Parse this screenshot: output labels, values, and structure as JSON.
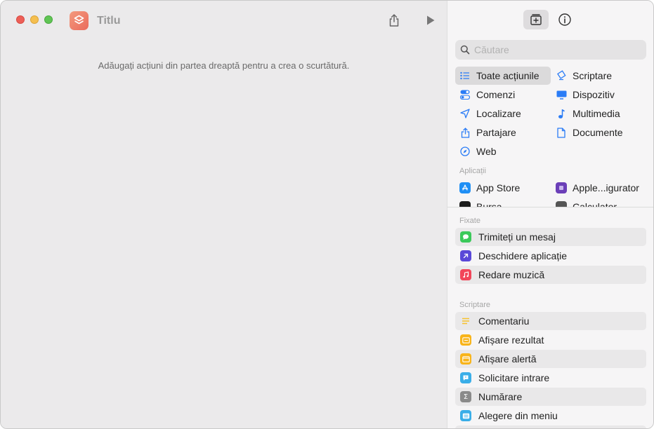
{
  "window": {
    "title": "Titlu",
    "empty_message": "Adăugați acțiuni din partea dreaptă pentru a crea o scurtătură."
  },
  "toolbar": {
    "share_icon": "share-icon",
    "run_icon": "play-icon"
  },
  "sidebar": {
    "library_icon": "action-library-icon",
    "info_icon": "info-icon",
    "search_placeholder": "Căutare",
    "categories": [
      {
        "label": "Toate acțiunile",
        "icon": "list-icon",
        "color": "#2a7cf6",
        "selected": true
      },
      {
        "label": "Scriptare",
        "icon": "scripting-icon",
        "color": "#2a7cf6"
      },
      {
        "label": "Comenzi",
        "icon": "toggle-icon",
        "color": "#2a7cf6"
      },
      {
        "label": "Dispozitiv",
        "icon": "display-icon",
        "color": "#2a7cf6"
      },
      {
        "label": "Localizare",
        "icon": "location-icon",
        "color": "#2a7cf6"
      },
      {
        "label": "Multimedia",
        "icon": "music-note-icon",
        "color": "#2a7cf6"
      },
      {
        "label": "Partajare",
        "icon": "share-icon",
        "color": "#2a7cf6"
      },
      {
        "label": "Documente",
        "icon": "document-icon",
        "color": "#2a7cf6"
      },
      {
        "label": "Web",
        "icon": "compass-icon",
        "color": "#2a7cf6"
      }
    ],
    "apps_label": "Aplicații",
    "apps": [
      {
        "label": "App Store",
        "icon": "app-store-icon",
        "color": "#1f8ff5"
      },
      {
        "label": "Apple...igurator",
        "icon": "configurator-icon",
        "color": "#6b3fb8"
      },
      {
        "label": "Bursa",
        "icon": "stocks-icon",
        "color": "#1c1c1c"
      },
      {
        "label": "Calculator",
        "icon": "calculator-icon",
        "color": "#555555"
      }
    ],
    "pinned_label": "Fixate",
    "pinned": [
      {
        "label": "Trimiteți un mesaj",
        "icon": "messages-icon",
        "color": "#3bc95a"
      },
      {
        "label": "Deschidere aplicație",
        "icon": "open-app-icon",
        "color": "#5a48d8"
      },
      {
        "label": "Redare muzică",
        "icon": "music-icon",
        "color": "#f2465a"
      }
    ],
    "scripting_label": "Scriptare",
    "scripting": [
      {
        "label": "Comentariu",
        "icon": "comment-icon",
        "color": "#f8c22c"
      },
      {
        "label": "Afișare rezultat",
        "icon": "show-result-icon",
        "color": "#f8b41a"
      },
      {
        "label": "Afișare alertă",
        "icon": "alert-icon",
        "color": "#f8b41a"
      },
      {
        "label": "Solicitare intrare",
        "icon": "ask-input-icon",
        "color": "#3aaee8"
      },
      {
        "label": "Numărare",
        "icon": "sigma-icon",
        "color": "#8a8a8a"
      },
      {
        "label": "Alegere din meniu",
        "icon": "menu-icon",
        "color": "#3aaee8"
      }
    ]
  }
}
